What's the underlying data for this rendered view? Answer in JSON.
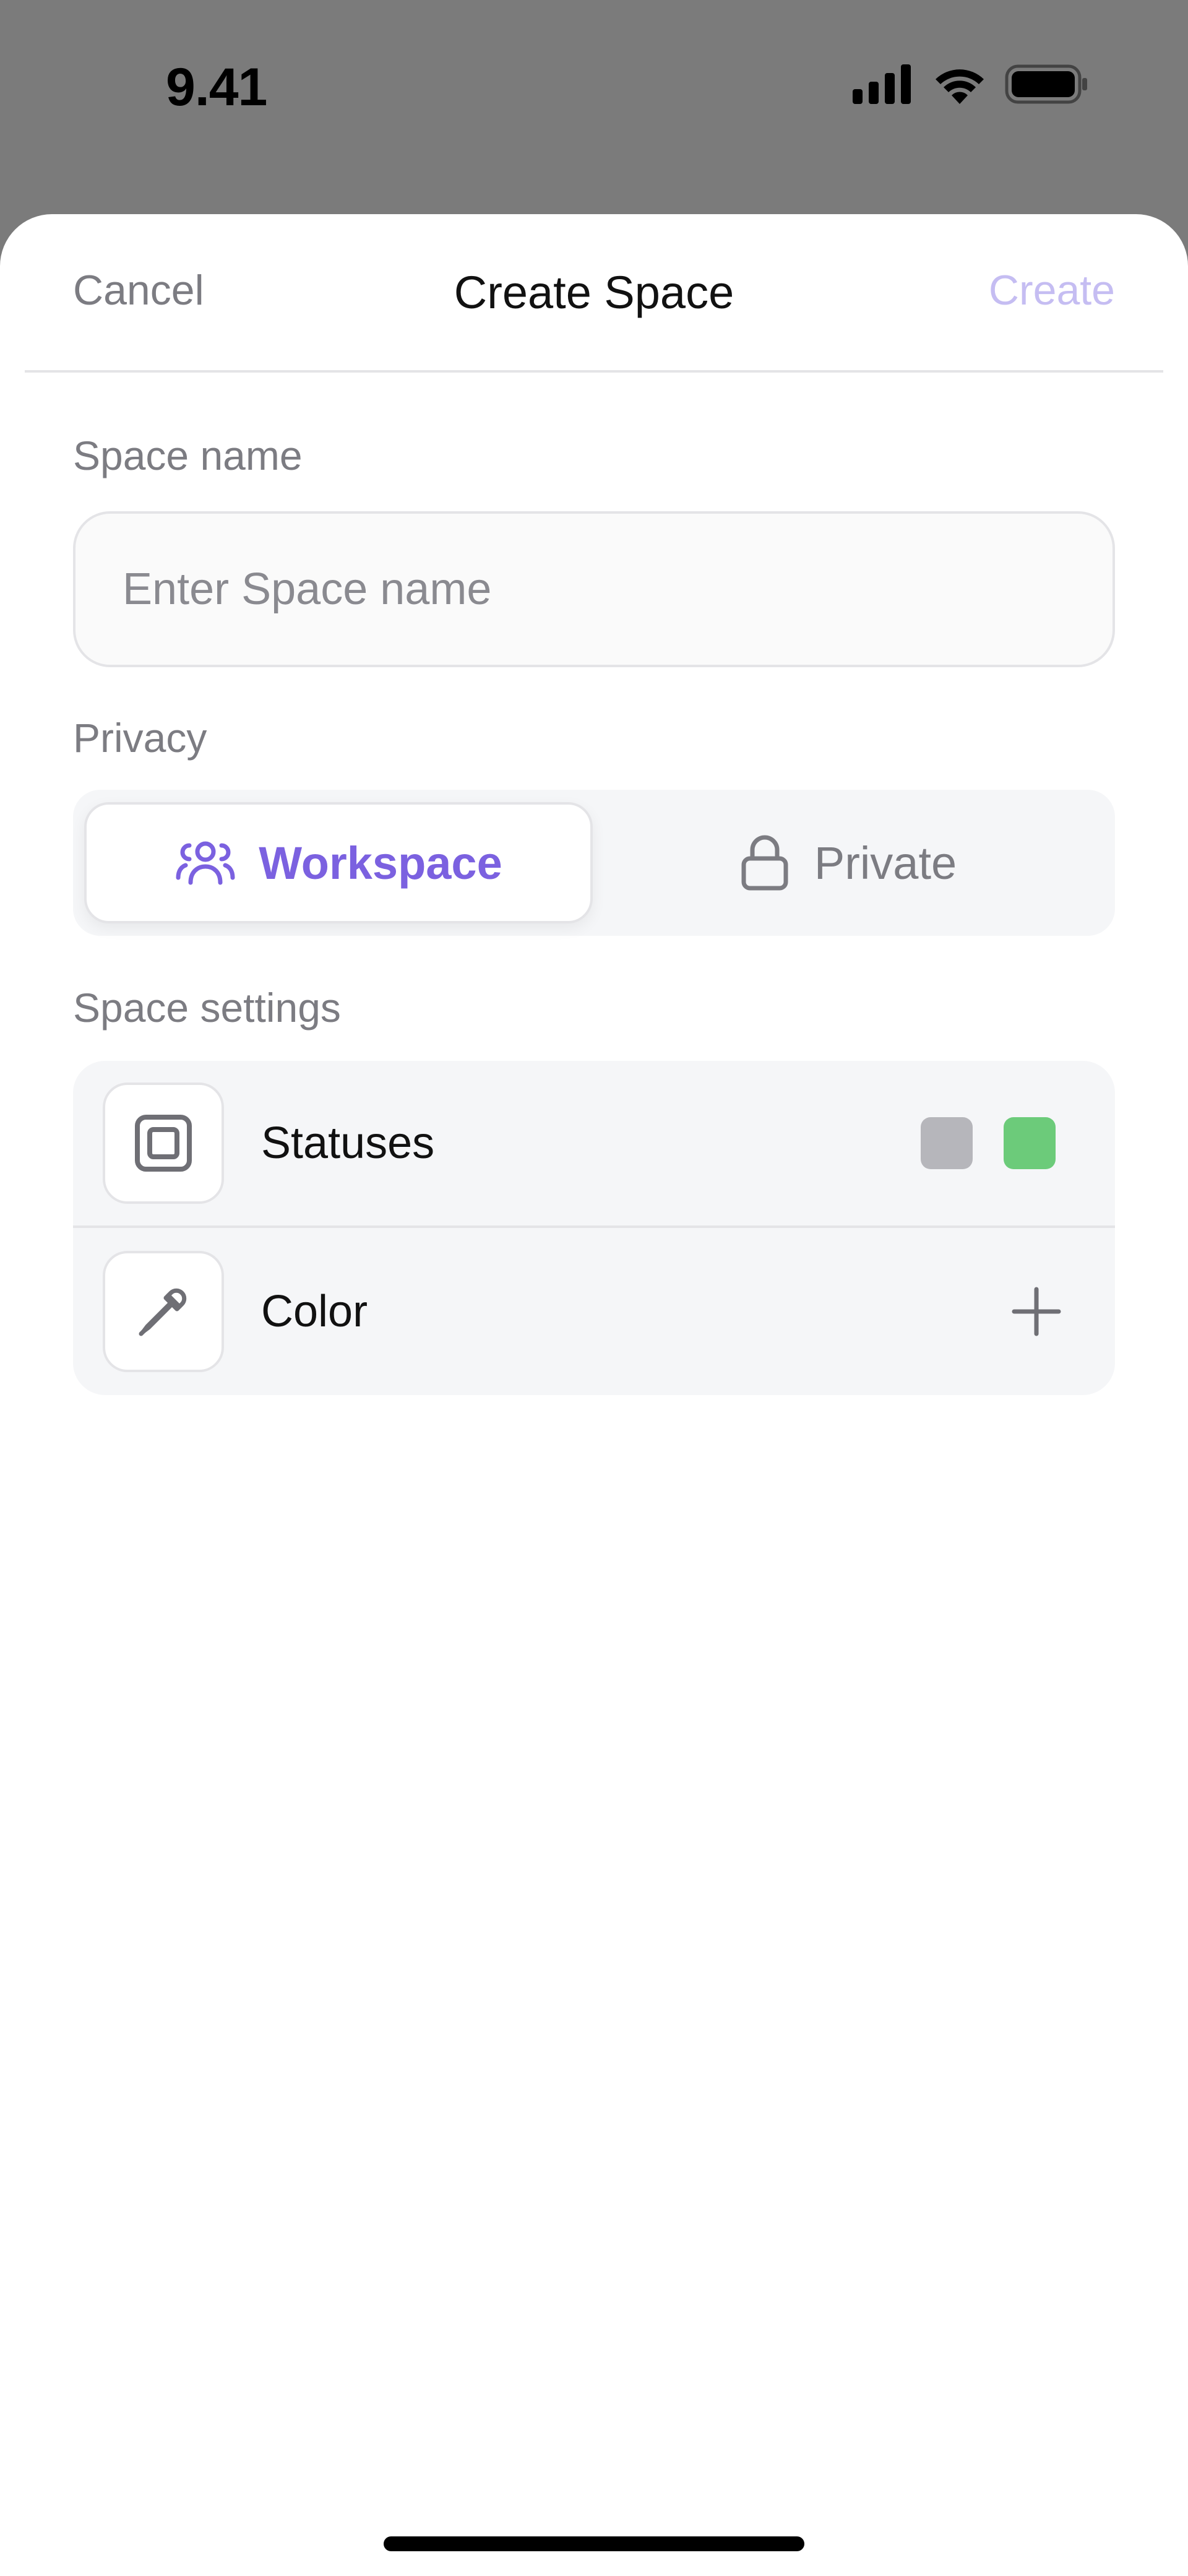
{
  "status_bar": {
    "time": "9.41"
  },
  "nav": {
    "cancel": "Cancel",
    "title": "Create Space",
    "create": "Create"
  },
  "form": {
    "space_name_label": "Space name",
    "space_name_placeholder": "Enter Space name",
    "space_name_value": "",
    "privacy_label": "Privacy",
    "privacy_options": [
      {
        "label": "Workspace",
        "icon": "users-icon",
        "selected": true
      },
      {
        "label": "Private",
        "icon": "lock-icon",
        "selected": false
      }
    ],
    "settings_label": "Space settings",
    "settings": [
      {
        "label": "Statuses",
        "icon": "statuses-icon",
        "swatches": [
          "#b6b6bb",
          "#6ccb7a"
        ]
      },
      {
        "label": "Color",
        "icon": "eyedropper-icon",
        "action": "plus-icon"
      }
    ]
  },
  "colors": {
    "accent": "#7b61e0",
    "create_disabled": "#c5bdf2",
    "muted_text": "#7c7c82"
  }
}
